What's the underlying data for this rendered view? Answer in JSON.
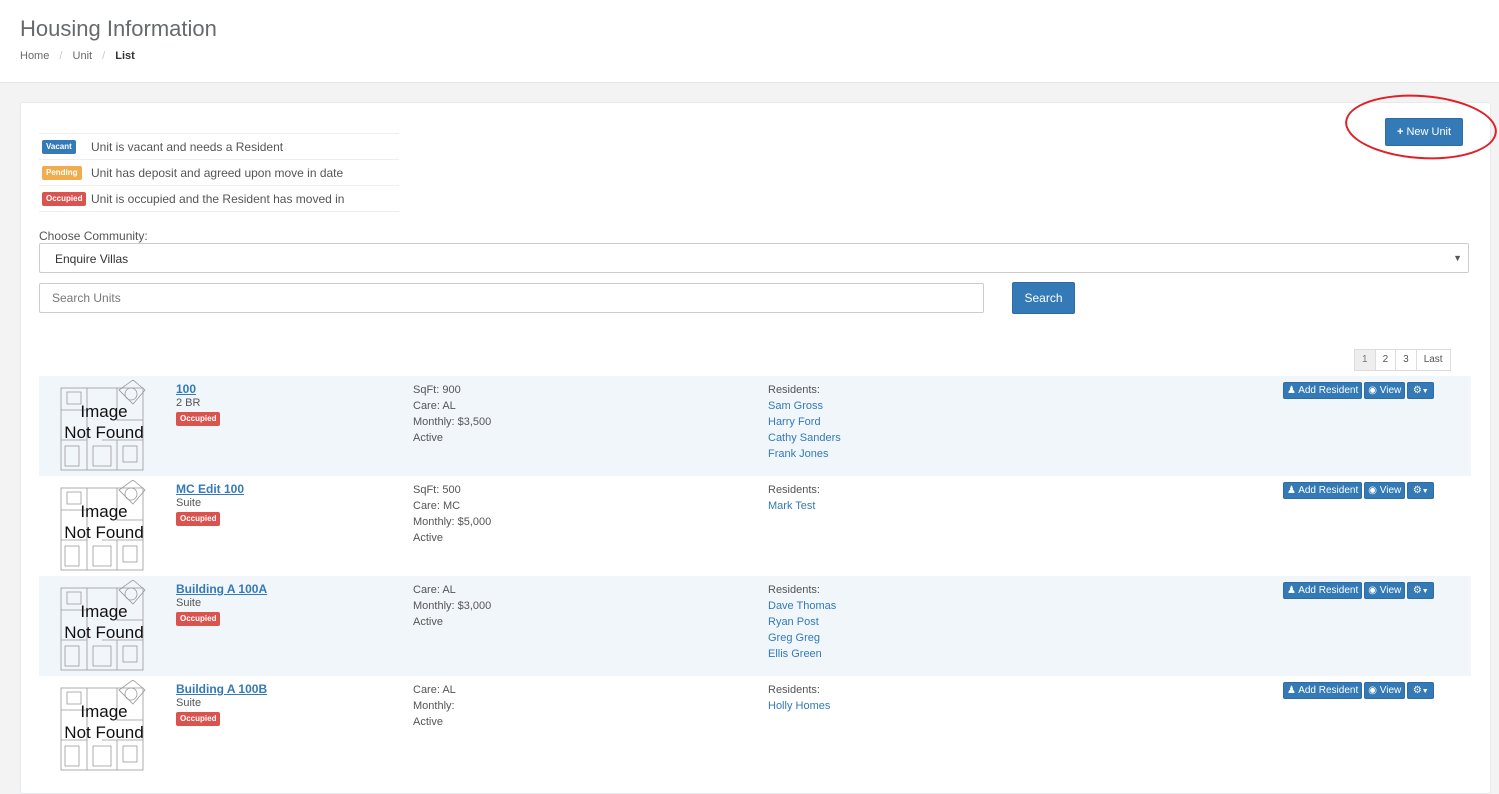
{
  "header": {
    "title": "Housing Information",
    "breadcrumb": [
      "Home",
      "Unit",
      "List"
    ]
  },
  "toolbar": {
    "new_unit_label": "New Unit"
  },
  "legend": [
    {
      "badge": "Vacant",
      "text": "Unit is vacant and needs a Resident",
      "color": "#337ab7"
    },
    {
      "badge": "Pending",
      "text": "Unit has deposit and agreed upon move in date",
      "color": "#f0ad4e"
    },
    {
      "badge": "Occupied",
      "text": "Unit is occupied and the Resident has moved in",
      "color": "#d9534f"
    }
  ],
  "filters": {
    "community_label": "Choose Community:",
    "community_value": "Enquire Villas",
    "search_placeholder": "Search Units",
    "search_button": "Search"
  },
  "pagination": {
    "pages": [
      "1",
      "2",
      "3"
    ],
    "last_label": "Last",
    "current": "1"
  },
  "image_placeholder": {
    "line1": "Image",
    "line2": "Not Found"
  },
  "units": [
    {
      "name": "100",
      "type": "2 BR",
      "status": "Occupied",
      "details": [
        "SqFt: 900",
        "Care: AL",
        "Monthly: $3,500",
        "Active"
      ],
      "residents_label": "Residents:",
      "residents": [
        "Sam Gross",
        "Harry Ford",
        "Cathy Sanders",
        "Frank Jones"
      ],
      "actions": {
        "add_resident": "Add Resident",
        "view": "View"
      }
    },
    {
      "name": "MC Edit 100",
      "type": "Suite",
      "status": "Occupied",
      "details": [
        "SqFt: 500",
        "Care: MC",
        "Monthly: $5,000",
        "Active"
      ],
      "residents_label": "Residents:",
      "residents": [
        "Mark Test"
      ],
      "actions": {
        "add_resident": "Add Resident",
        "view": "View"
      }
    },
    {
      "name": "Building A 100A",
      "type": "Suite",
      "status": "Occupied",
      "details": [
        "Care: AL",
        "Monthly: $3,000",
        "Active"
      ],
      "residents_label": "Residents:",
      "residents": [
        "Dave Thomas",
        "Ryan Post",
        "Greg Greg",
        "Ellis Green"
      ],
      "actions": {
        "add_resident": "Add Resident",
        "view": "View"
      }
    },
    {
      "name": "Building A 100B",
      "type": "Suite",
      "status": "Occupied",
      "details": [
        "Care: AL",
        "Monthly:",
        "Active"
      ],
      "residents_label": "Residents:",
      "residents": [
        "Holly Homes"
      ],
      "actions": {
        "add_resident": "Add Resident",
        "view": "View"
      }
    }
  ],
  "colors": {
    "primary": "#337ab7",
    "pending": "#f0ad4e",
    "occupied": "#d9534f",
    "annotation": "#e01f26"
  },
  "icons": {
    "new_unit": "plus-icon",
    "add_resident": "user-icon",
    "view": "eye-icon",
    "settings": "gear-icon",
    "dropdown": "caret-down-icon"
  }
}
